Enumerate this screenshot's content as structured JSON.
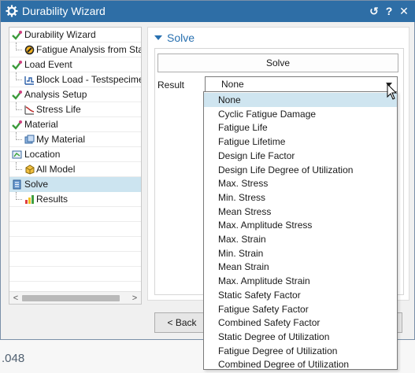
{
  "window": {
    "title": "Durability Wizard",
    "controls": [
      "↺",
      "?",
      "✕"
    ]
  },
  "tree": {
    "items": [
      {
        "label": "Durability Wizard",
        "icon": "check-node-icon",
        "level": 0
      },
      {
        "label": "Fatigue Analysis from Stat",
        "icon": "fatigue-analysis-icon",
        "level": 1
      },
      {
        "label": "Load Event",
        "icon": "check-node-icon",
        "level": 0
      },
      {
        "label": "Block Load - Testspecimen",
        "icon": "block-load-icon",
        "level": 1
      },
      {
        "label": "Analysis Setup",
        "icon": "check-node-icon",
        "level": 0
      },
      {
        "label": "Stress Life",
        "icon": "stress-life-icon",
        "level": 1
      },
      {
        "label": "Material",
        "icon": "check-node-icon",
        "level": 0
      },
      {
        "label": "My Material",
        "icon": "material-icon",
        "level": 1
      },
      {
        "label": "Location",
        "icon": "location-icon",
        "level": 0
      },
      {
        "label": "All Model",
        "icon": "model-icon",
        "level": 1
      },
      {
        "label": "Solve",
        "icon": "solve-icon",
        "level": 0,
        "selected": true
      },
      {
        "label": "Results",
        "icon": "results-icon",
        "level": 1
      }
    ]
  },
  "panel": {
    "section_title": "Solve",
    "solve_label": "Solve",
    "result_label": "Result",
    "result_value": "None"
  },
  "buttons": {
    "back_label": "< Back"
  },
  "dropdown": {
    "options": [
      "None",
      "Cyclic Fatigue Damage",
      "Fatigue Life",
      "Fatigue Lifetime",
      "Design Life Factor",
      "Design Life Degree of Utilization",
      "Max. Stress",
      "Min. Stress",
      "Mean Stress",
      "Max. Amplitude Stress",
      "Max. Strain",
      "Min. Strain",
      "Mean Strain",
      "Max. Amplitude Strain",
      "Static Safety Factor",
      "Fatigue Safety Factor",
      "Combined Safety Factor",
      "Static Degree of Utilization",
      "Fatigue Degree of Utilization",
      "Combined Degree of Utilization"
    ],
    "highlighted_index": 0
  },
  "status": {
    "value": ".048"
  },
  "colors": {
    "titlebar": "#2e6ea6",
    "accent": "#2870b0",
    "selection": "#cce4f0"
  }
}
